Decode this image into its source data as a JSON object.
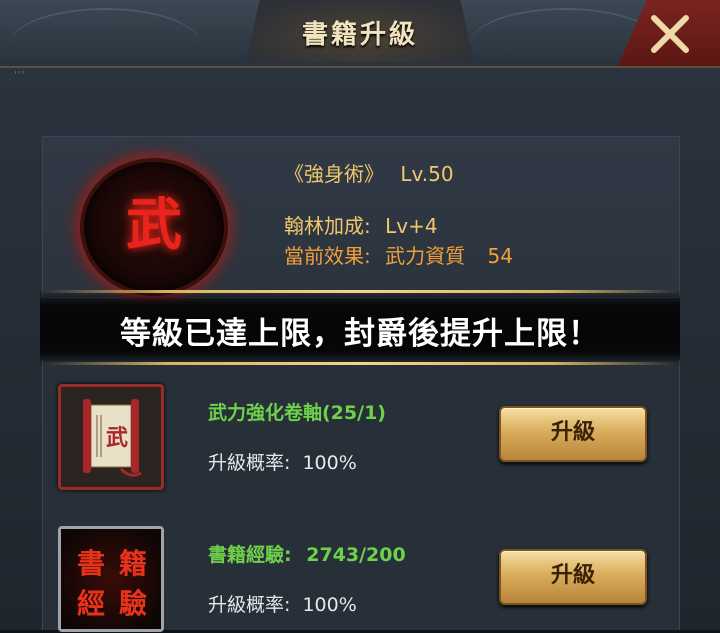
{
  "header": {
    "title": "書籍升級",
    "dots": "'''"
  },
  "book": {
    "icon_char": "武",
    "name": "《強身術》",
    "level": "Lv.50",
    "bonus_label": "翰林加成:",
    "bonus_value": "Lv+4",
    "effect_label": "當前效果:",
    "effect_name": "武力資質",
    "effect_value": "54"
  },
  "notice": "等級已達上限，封爵後提升上限！",
  "items": [
    {
      "name": "武力強化卷軸(25/1)",
      "rate_label": "升級概率:",
      "rate_value": "100%",
      "button": "升級",
      "icon_char": "武"
    },
    {
      "name": "書籍經驗:",
      "count": "2743/200",
      "rate_label": "升級概率:",
      "rate_value": "100%",
      "button": "升級",
      "icon_text": [
        "書",
        "籍",
        "經",
        "驗"
      ]
    }
  ],
  "colors": {
    "gold_text": "#f0c86a",
    "orange_text": "#f0a038",
    "green_text": "#6fd14a",
    "close_red": "#7a2420",
    "button_gold": "#d9ad5c"
  }
}
